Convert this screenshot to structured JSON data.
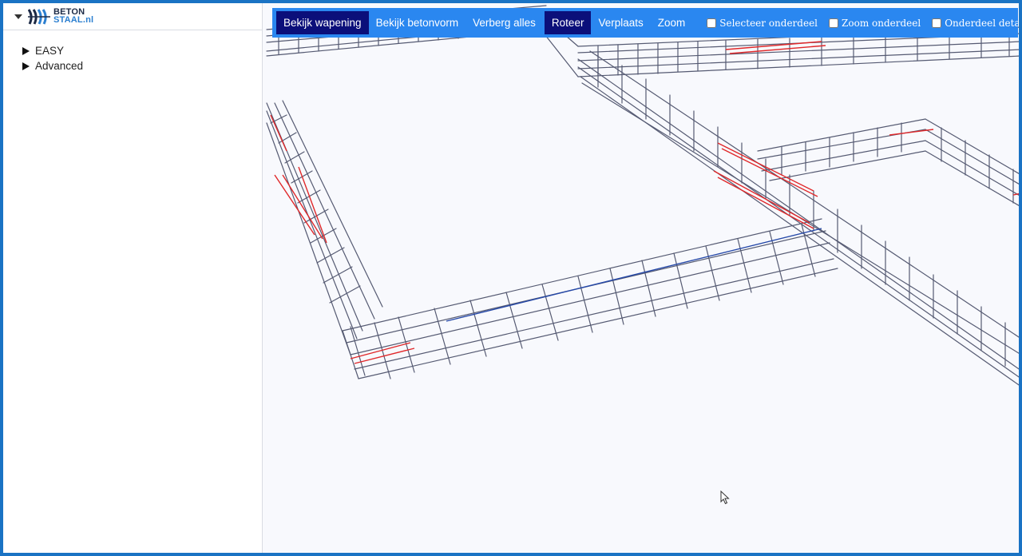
{
  "sidebar": {
    "logo": {
      "line1": "BETON",
      "line2": "STAAL.nl"
    },
    "tree": [
      {
        "label": "EASY"
      },
      {
        "label": "Advanced"
      }
    ]
  },
  "toolbar": {
    "bekijk_wapening": "Bekijk wapening",
    "bekijk_betonvorm": "Bekijk betonvorm",
    "verberg_alles": "Verberg alles",
    "roteer": "Roteer",
    "verplaats": "Verplaats",
    "zoom": "Zoom",
    "selecteer_onderdeel": "Selecteer onderdeel",
    "zoom_onderdeel": "Zoom onderdeel",
    "onderdeel_details": "Onderdeel details"
  },
  "colors": {
    "frame_border": "#1a73c4",
    "toolbar_bg": "#2a87f0",
    "active_button": "#0b0f7a",
    "rebar": "#4a4f66",
    "rebar_highlight_red": "#e0282a",
    "rebar_highlight_blue": "#2548a8"
  },
  "icons": [
    "caret-down-icon",
    "tree-arrow-icon",
    "betonstaal-logo",
    "mouse-cursor-icon"
  ]
}
